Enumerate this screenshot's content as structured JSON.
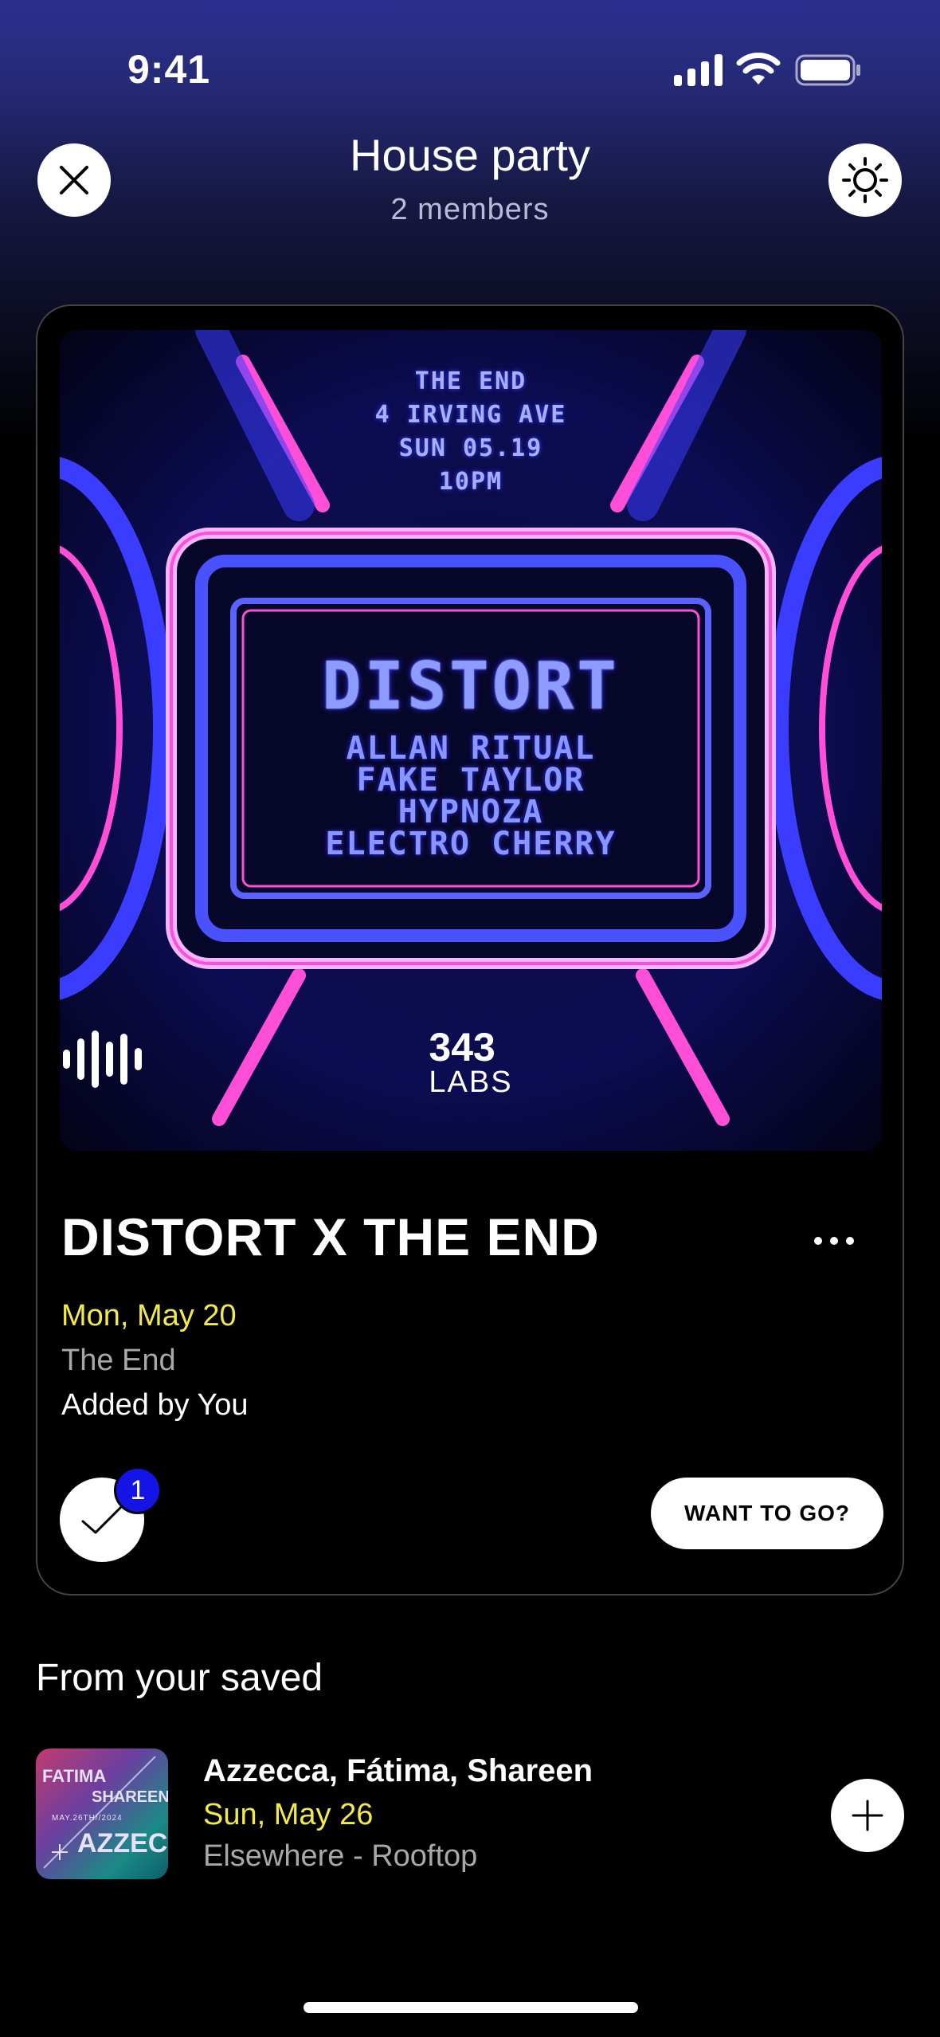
{
  "status_bar": {
    "time": "9:41"
  },
  "header": {
    "title": "House party",
    "subtitle": "2 members"
  },
  "poster": {
    "info_lines": [
      "THE END",
      "4 IRVING AVE",
      "SUN 05.19",
      "10PM"
    ],
    "headline": "DISTORT",
    "lineup": [
      "ALLAN RITUAL",
      "FAKE TAYLOR",
      "HYPNOZA",
      "ELECTRO CHERRY"
    ],
    "logo_number": "343",
    "logo_word": "LABS"
  },
  "event": {
    "title": "DISTORT X THE END",
    "date": "Mon, May 20",
    "venue": "The End",
    "added_by": "Added by You",
    "attend_count": "1",
    "want_to_go_label": "WANT TO GO?"
  },
  "saved": {
    "section_title": "From your saved",
    "items": [
      {
        "name": "Azzecca, Fátima, Shareen",
        "date": "Sun, May 26",
        "venue": "Elsewhere - Rooftop",
        "thumb_lines": [
          "FATIMA",
          "SHAREEN",
          "MAY.26TH//2024",
          "AZZECCA"
        ]
      }
    ]
  },
  "colors": {
    "accent_date": "#f2ea4b",
    "badge": "#1414e6",
    "poster_neon": "#5a5cff",
    "poster_pink": "#ff4fd8"
  },
  "icons": [
    "close-icon",
    "sun-icon",
    "check-icon",
    "more-icon",
    "plus-icon",
    "signal-icon",
    "wifi-icon",
    "battery-icon"
  ]
}
